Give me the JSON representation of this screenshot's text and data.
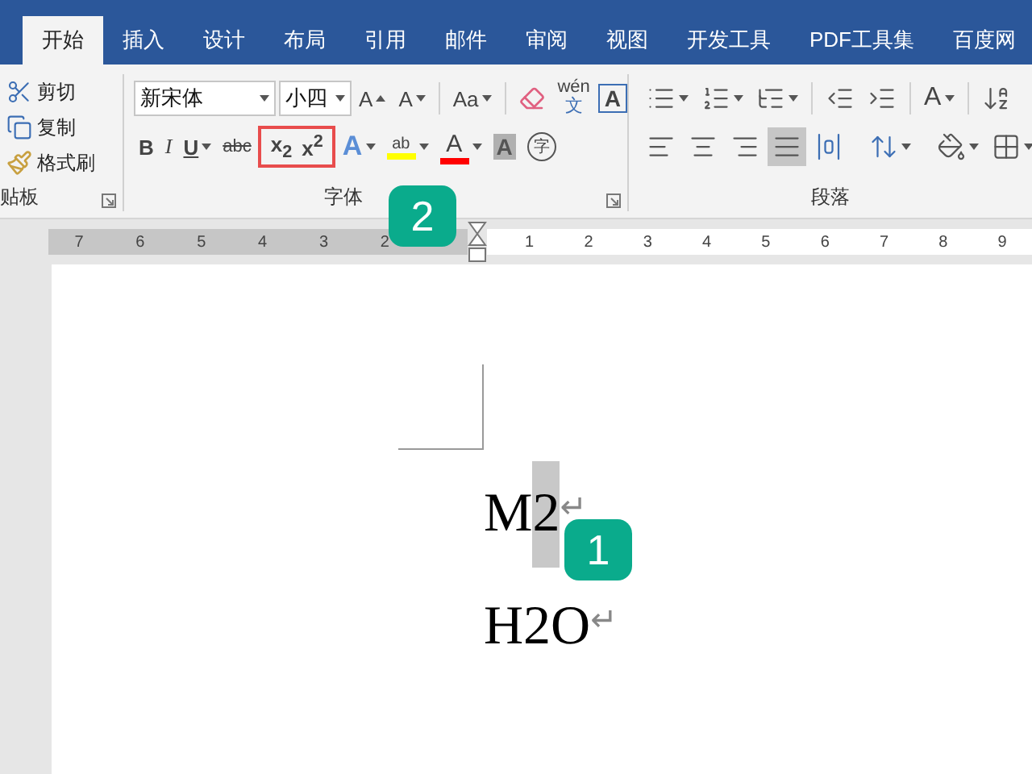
{
  "tabs": [
    {
      "label": "开始",
      "selected": true
    },
    {
      "label": "插入",
      "selected": false
    },
    {
      "label": "设计",
      "selected": false
    },
    {
      "label": "布局",
      "selected": false
    },
    {
      "label": "引用",
      "selected": false
    },
    {
      "label": "邮件",
      "selected": false
    },
    {
      "label": "审阅",
      "selected": false
    },
    {
      "label": "视图",
      "selected": false
    },
    {
      "label": "开发工具",
      "selected": false
    },
    {
      "label": "PDF工具集",
      "selected": false
    },
    {
      "label": "百度网",
      "selected": false
    }
  ],
  "clipboard": {
    "group_label": "贴板",
    "items": [
      {
        "kind": "cut",
        "label": "剪切"
      },
      {
        "kind": "copy",
        "label": "复制"
      },
      {
        "kind": "painter",
        "label": "格式刷"
      }
    ]
  },
  "font": {
    "group_label": "字体",
    "font_name": "新宋体",
    "font_size": "小四",
    "top_buttons": [
      {
        "kind": "grow",
        "label": "A"
      },
      {
        "kind": "shrink",
        "label": "A"
      },
      {
        "kind": "case",
        "label": "Aa"
      },
      {
        "kind": "clear"
      },
      {
        "kind": "phonetic",
        "label": "wén",
        "sublabel": "文"
      },
      {
        "kind": "border",
        "label": "A"
      }
    ],
    "format_buttons": [
      {
        "kind": "bold",
        "label": "B"
      },
      {
        "kind": "italic",
        "label": "I"
      },
      {
        "kind": "underline",
        "label": "U"
      },
      {
        "kind": "strike",
        "label": "abc"
      },
      {
        "kind": "subscript",
        "label": "x$_{2}$",
        "marked": true
      },
      {
        "kind": "superscript",
        "label": "x$^{2}$",
        "marked": true
      },
      {
        "kind": "effects",
        "label": "A"
      },
      {
        "kind": "highlight",
        "label": "ab",
        "color": "#ffff00"
      },
      {
        "kind": "fontcolor",
        "label": "A",
        "color": "#ff0000"
      },
      {
        "kind": "shading",
        "label": "A"
      },
      {
        "kind": "enclose",
        "label": "字"
      }
    ]
  },
  "paragraph": {
    "group_label": "段落",
    "top_buttons": [
      {
        "kind": "bullets"
      },
      {
        "kind": "numbering"
      },
      {
        "kind": "multilevel"
      },
      {
        "kind": "outdent"
      },
      {
        "kind": "indent"
      },
      {
        "kind": "layout",
        "label": "A"
      },
      {
        "kind": "sort"
      }
    ],
    "bottom_buttons": [
      {
        "kind": "left",
        "selected": false
      },
      {
        "kind": "center",
        "selected": false
      },
      {
        "kind": "right",
        "selected": false
      },
      {
        "kind": "justify",
        "selected": true
      },
      {
        "kind": "distribute",
        "selected": false
      },
      {
        "kind": "spacing"
      },
      {
        "kind": "fill"
      },
      {
        "kind": "borders"
      }
    ]
  },
  "ruler": {
    "left_numbers": [
      "7",
      "6",
      "5",
      "4",
      "3",
      "2"
    ],
    "right_numbers": [
      "1",
      "2",
      "3",
      "4",
      "5",
      "6",
      "7",
      "8",
      "9"
    ]
  },
  "document": {
    "lines": [
      {
        "segments": [
          {
            "text": "M",
            "selected": false
          },
          {
            "text": "2",
            "selected": true
          }
        ],
        "mark": "↵"
      },
      {
        "segments": [
          {
            "text": "H2O",
            "selected": false
          }
        ],
        "mark": "↵"
      }
    ]
  },
  "callouts": [
    "1",
    "2"
  ]
}
